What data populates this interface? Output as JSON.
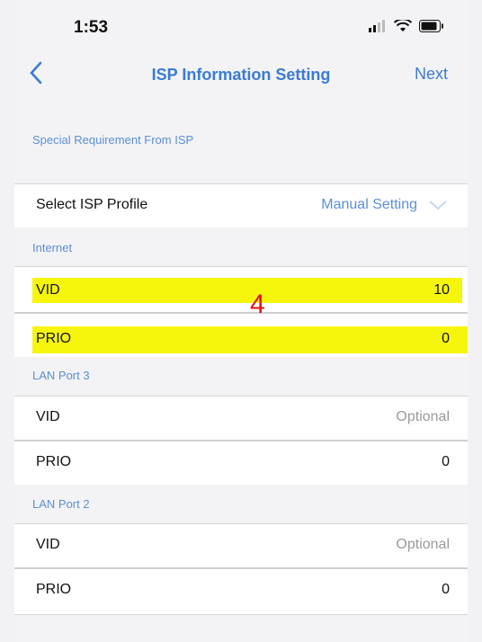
{
  "status": {
    "time": "1:53"
  },
  "nav": {
    "back_icon": "chevron-left-icon",
    "title": "ISP Information Setting",
    "next_label": "Next"
  },
  "special": {
    "heading": "Special Requirement From ISP"
  },
  "profile": {
    "label": "Select ISP Profile",
    "value": "Manual Setting"
  },
  "internet": {
    "heading": "Internet",
    "vid": {
      "label": "VID",
      "value": "10"
    },
    "prio": {
      "label": "PRIO",
      "value": "0"
    }
  },
  "lan3": {
    "heading": "LAN Port 3",
    "vid": {
      "label": "VID",
      "placeholder": "Optional"
    },
    "prio": {
      "label": "PRIO",
      "value": "0"
    }
  },
  "lan2": {
    "heading": "LAN Port 2",
    "vid": {
      "label": "VID",
      "placeholder": "Optional"
    },
    "prio": {
      "label": "PRIO",
      "value": "0"
    }
  },
  "annotation": {
    "text": "4"
  },
  "colors": {
    "accent": "#3a7bd5",
    "highlight": "#f6f500",
    "annotation": "#e01010"
  }
}
